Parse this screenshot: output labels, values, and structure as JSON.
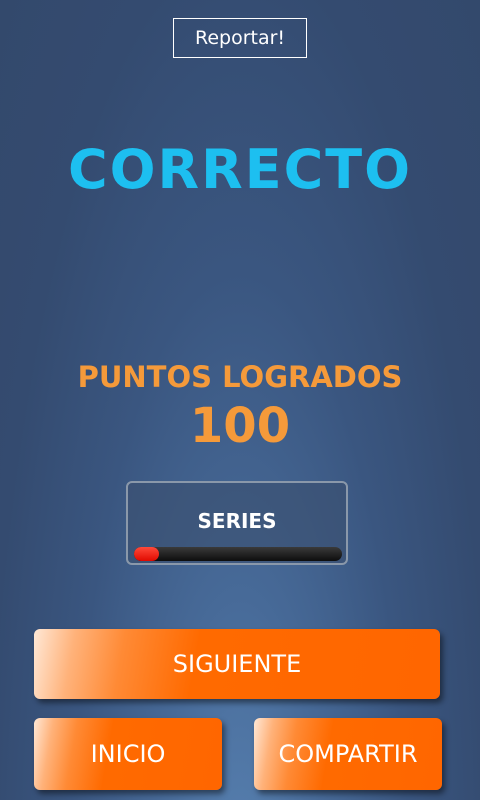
{
  "header": {
    "report_label": "Reportar!"
  },
  "result": {
    "title": "CORRECTO"
  },
  "score": {
    "label": "PUNTOS LOGRADOS",
    "value": "100"
  },
  "series": {
    "label": "SERIES",
    "progress_fraction": 0.12
  },
  "actions": {
    "next_label": "SIGUIENTE",
    "home_label": "INICIO",
    "share_label": "COMPARTIR"
  },
  "colors": {
    "title": "#1dbff0",
    "score": "#f59a3a",
    "button": "#ff6600",
    "progress_fill": "#e10a00"
  }
}
